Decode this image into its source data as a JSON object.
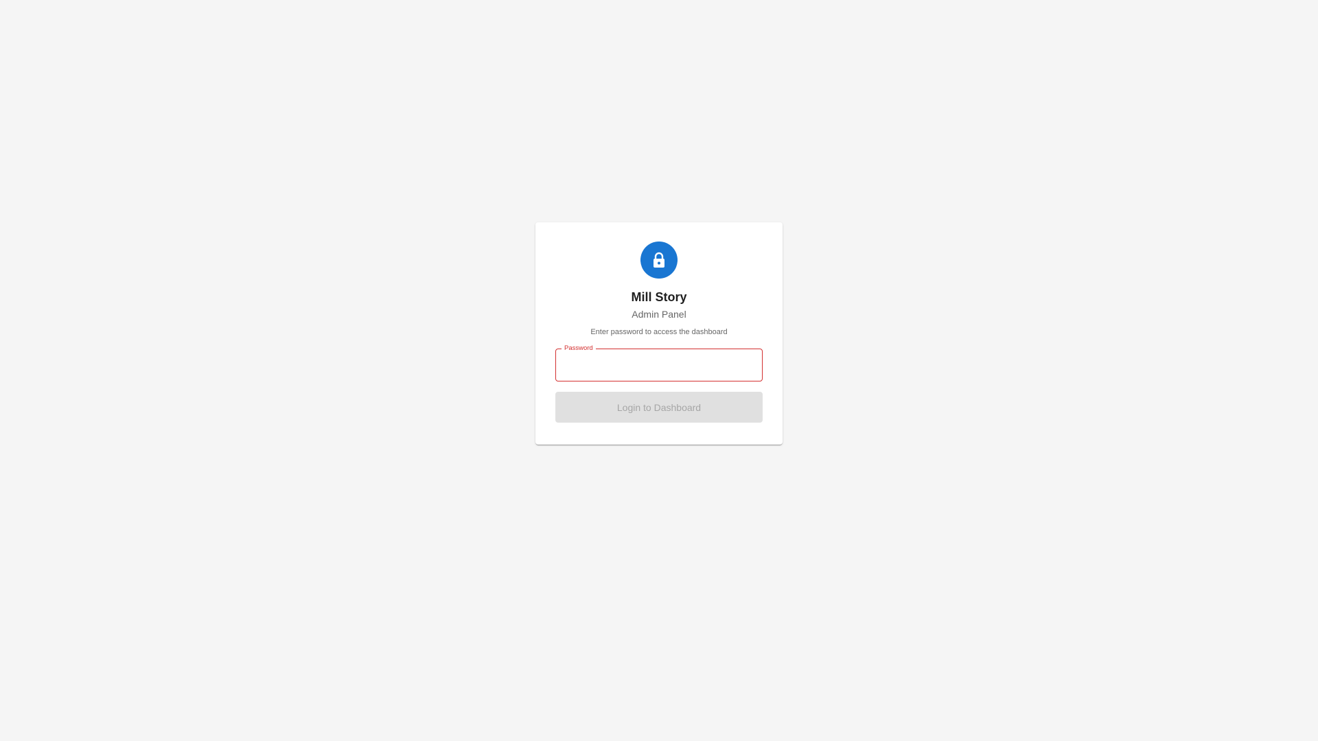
{
  "login": {
    "title": "Mill Story",
    "subtitle": "Admin Panel",
    "hint": "Enter password to access the dashboard",
    "password_label": "Password",
    "password_value": "",
    "submit_label": "Login to Dashboard",
    "submit_disabled": true,
    "icon": "lock-icon"
  },
  "colors": {
    "background": "#f5f5f5",
    "card": "#ffffff",
    "accent": "#1976d2",
    "error": "#d32f2f",
    "button_disabled_bg": "#e0e0e0",
    "button_disabled_text": "#a6a6a6"
  }
}
